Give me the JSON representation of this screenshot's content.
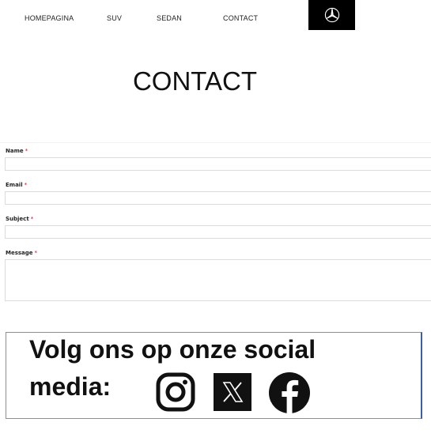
{
  "nav": {
    "items": [
      "HOMEPAGINA",
      "SUV",
      "SEDAN",
      "CONTACT"
    ],
    "logo_icon": "mercedes-star-icon"
  },
  "page": {
    "title": "CONTACT"
  },
  "form": {
    "required_marker": "*",
    "fields": [
      {
        "label": "Name",
        "value": ""
      },
      {
        "label": "Email",
        "value": ""
      },
      {
        "label": "Subject",
        "value": ""
      },
      {
        "label": "Message",
        "value": ""
      }
    ]
  },
  "social": {
    "line1": "Volg ons op onze social",
    "line2": "media:",
    "icons": [
      "instagram-icon",
      "x-icon",
      "facebook-icon"
    ]
  },
  "colors": {
    "required": "#d1001f",
    "logo_bg": "#000000",
    "banner_border": "#8f8f8f",
    "banner_accent": "#3b5fa8"
  }
}
